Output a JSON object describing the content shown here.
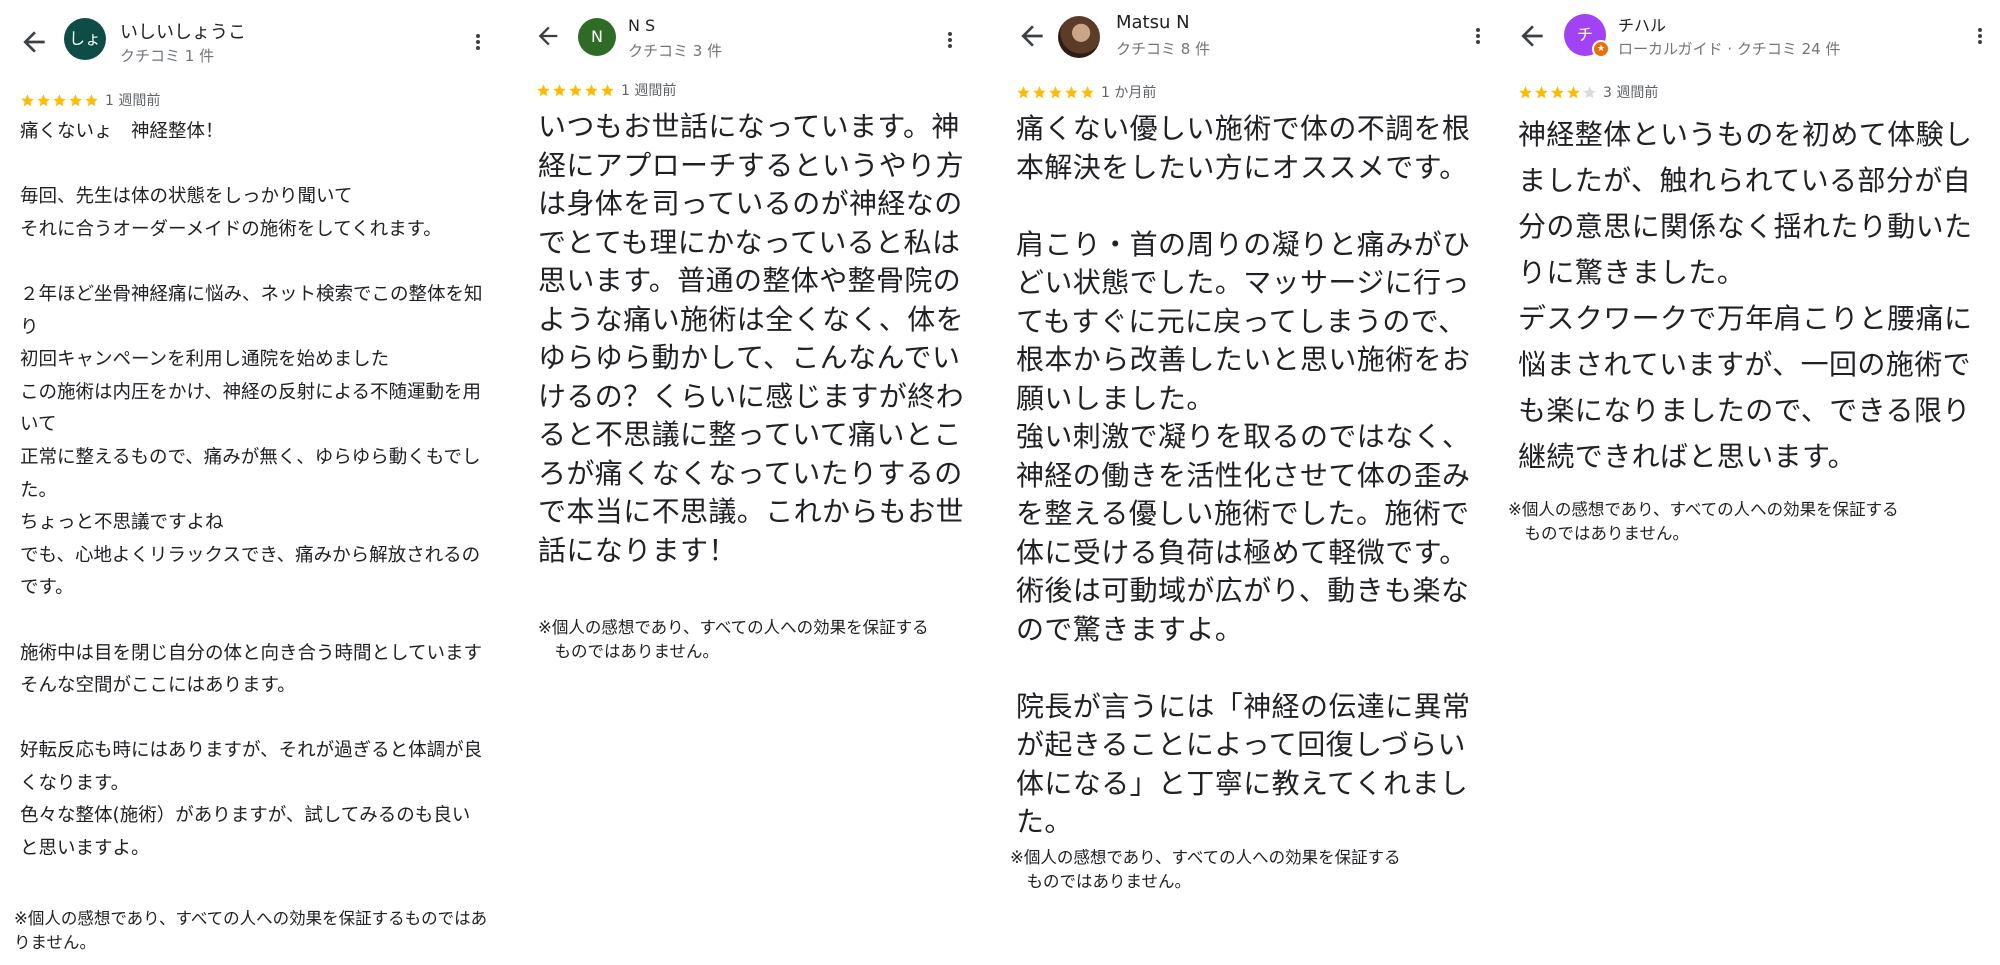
{
  "colors": {
    "star_filled": "#fbbc04",
    "star_empty": "#dadce0",
    "meta_text": "#70757a",
    "avatar_1": "#0d4d46",
    "avatar_2": "#2e6b25",
    "avatar_4": "#a142f4",
    "guide_badge": "#e8710a"
  },
  "reviews": [
    {
      "reviewer": "いしいしょうこ",
      "avatar_text": "しょ",
      "meta": "クチコミ 1 件",
      "stars": 5,
      "time": "1 週間前",
      "text": "痛くないょ　神経整体！\n\n毎回、先生は体の状態をしっかり聞いて\nそれに合うオーダーメイドの施術をしてくれます。\n\n２年ほど坐骨神経痛に悩み、ネット検索でこの整体を知り\n初回キャンペーンを利用し通院を始めました\nこの施術は内圧をかけ、神経の反射による不随運動を用いて\n正常に整えるもので、痛みが無く、ゆらゆら動くもでした。\nちょっと不思議ですよね\nでも、心地よくリラックスでき、痛みから解放されるのです。\n\n施術中は目を閉じ自分の体と向き合う時間としています\nそんな空間がここにはあります。\n\n好転反応も時にはありますが、それが過ぎると体調が良くなります。\n色々な整体(施術）がありますが、試してみるのも良いと思いますよ。",
      "disclaimer": "※個人の感想であり、すべての人への効果を保証するものではありません。"
    },
    {
      "reviewer": "N S",
      "avatar_text": "N",
      "meta": "クチコミ 3 件",
      "stars": 5,
      "time": "1 週間前",
      "text": "いつもお世話になっています。神経にアプローチするというやり方は身体を司っているのが神経なのでとても理にかなっていると私は思います。普通の整体や整骨院のような痛い施術は全くなく、体をゆらゆら動かして、こんなんでいけるの？くらいに感じますが終わると不思議に整っていて痛いところが痛くなくなっていたりするので本当に不思議。これからもお世話になります！",
      "disclaimer": "※個人の感想であり、すべての人への効果を保証する\n　ものではありません。"
    },
    {
      "reviewer": "Matsu N",
      "avatar_text": "",
      "meta": "クチコミ 8 件",
      "stars": 5,
      "time": "1 か月前",
      "text": "痛くない優しい施術で体の不調を根本解決をしたい方にオススメです。\n\n肩こり・首の周りの凝りと痛みがひどい状態でした。マッサージに行ってもすぐに元に戻ってしまうので、根本から改善したいと思い施術をお願いしました。\n強い刺激で凝りを取るのではなく、神経の働きを活性化させて体の歪みを整える優しい施術でした。施術で体に受ける負荷は極めて軽微です。術後は可動域が広がり、動きも楽なので驚きますよ。\n\n院長が言うには「神経の伝達に異常が起きることによって回復しづらい体になる」と丁寧に教えてくれました。",
      "disclaimer": "※個人の感想であり、すべての人への効果を保証する\n　ものではありません。"
    },
    {
      "reviewer": "チハル",
      "avatar_text": "チ",
      "meta": "ローカルガイド · クチコミ 24 件",
      "stars": 4,
      "time": "3 週間前",
      "text": "神経整体というものを初めて体験しましたが、触れられている部分が自分の意思に関係なく揺れたり動いたりに驚きました。\nデスクワークで万年肩こりと腰痛に悩まされていますが、一回の施術でも楽になりましたので、できる限り継続できればと思います。",
      "disclaimer": "※個人の感想であり、すべての人への効果を保証する\n　ものではありません。"
    }
  ]
}
